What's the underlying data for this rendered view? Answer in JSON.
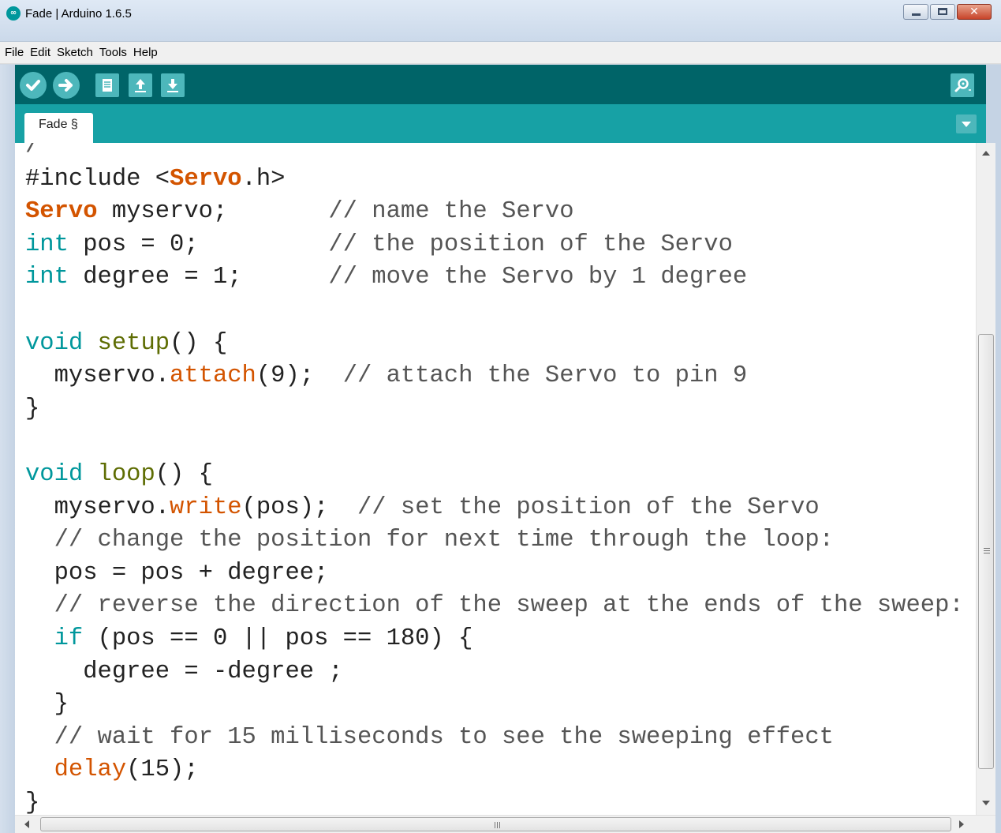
{
  "window": {
    "title": "Fade | Arduino 1.6.5",
    "icon": "arduino-logo-icon",
    "controls": [
      "minimize-icon",
      "maximize-icon",
      "close-icon"
    ]
  },
  "menu": [
    "File",
    "Edit",
    "Sketch",
    "Tools",
    "Help"
  ],
  "toolbar": {
    "buttons": [
      "verify-icon",
      "upload-icon",
      "new-icon",
      "open-icon",
      "save-icon"
    ],
    "right_button": "serial-monitor-icon",
    "background": "#006468",
    "button_color": "#4db7bb"
  },
  "tabs": [
    {
      "label": "Fade §",
      "active": true
    }
  ],
  "tab_strip_color": "#17a1a5",
  "syntax_colors": {
    "keyword": "#00979c",
    "function": "#5e6d03",
    "class": "#d35400",
    "comment": "#555555"
  },
  "code": [
    [
      {
        "t": "/",
        "c": "cm"
      }
    ],
    [
      {
        "t": "#include <"
      },
      {
        "t": "Servo",
        "c": "cls"
      },
      {
        "t": ".h>"
      }
    ],
    [
      {
        "t": "Servo",
        "c": "cls"
      },
      {
        "t": " myservo;       "
      },
      {
        "t": "// name the Servo",
        "c": "cm"
      }
    ],
    [
      {
        "t": "int",
        "c": "kw"
      },
      {
        "t": " pos = 0;         "
      },
      {
        "t": "// the position of the Servo",
        "c": "cm"
      }
    ],
    [
      {
        "t": "int",
        "c": "kw"
      },
      {
        "t": " degree = 1;      "
      },
      {
        "t": "// move the Servo by 1 degree",
        "c": "cm"
      }
    ],
    [
      {
        "t": ""
      }
    ],
    [
      {
        "t": "void",
        "c": "kw"
      },
      {
        "t": " "
      },
      {
        "t": "setup",
        "c": "fn"
      },
      {
        "t": "() {"
      }
    ],
    [
      {
        "t": "  myservo."
      },
      {
        "t": "attach",
        "c": "meth"
      },
      {
        "t": "(9);  "
      },
      {
        "t": "// attach the Servo to pin 9",
        "c": "cm"
      }
    ],
    [
      {
        "t": "}"
      }
    ],
    [
      {
        "t": ""
      }
    ],
    [
      {
        "t": "void",
        "c": "kw"
      },
      {
        "t": " "
      },
      {
        "t": "loop",
        "c": "fn"
      },
      {
        "t": "() {"
      }
    ],
    [
      {
        "t": "  myservo."
      },
      {
        "t": "write",
        "c": "meth"
      },
      {
        "t": "(pos);  "
      },
      {
        "t": "// set the position of the Servo",
        "c": "cm"
      }
    ],
    [
      {
        "t": "  "
      },
      {
        "t": "// change the position for next time through the loop:",
        "c": "cm"
      }
    ],
    [
      {
        "t": "  pos = pos + degree;"
      }
    ],
    [
      {
        "t": "  "
      },
      {
        "t": "// reverse the direction of the sweep at the ends of the sweep:",
        "c": "cm"
      }
    ],
    [
      {
        "t": "  "
      },
      {
        "t": "if",
        "c": "kw"
      },
      {
        "t": " (pos == 0 || pos == 180) {"
      }
    ],
    [
      {
        "t": "    degree = -degree ;"
      }
    ],
    [
      {
        "t": "  }"
      }
    ],
    [
      {
        "t": "  "
      },
      {
        "t": "// wait for 15 milliseconds to see the sweeping effect",
        "c": "cm"
      }
    ],
    [
      {
        "t": "  "
      },
      {
        "t": "delay",
        "c": "meth"
      },
      {
        "t": "(15);"
      }
    ],
    [
      {
        "t": "}"
      }
    ]
  ]
}
